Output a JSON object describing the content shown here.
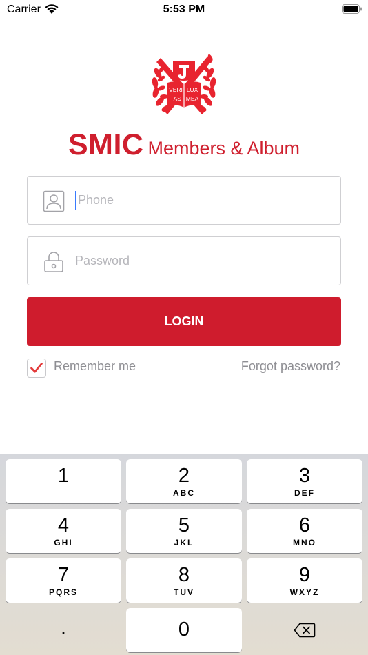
{
  "status_bar": {
    "carrier": "Carrier",
    "time": "5:53 PM",
    "wifi_icon": "wifi-icon",
    "battery_icon": "battery-icon"
  },
  "logo": {
    "icon": "university-crest-icon",
    "motto_lines": [
      "VERI",
      "LUX",
      "TAS",
      "MEA"
    ],
    "color": "#cf1f2e"
  },
  "brand": {
    "main": "SMIC",
    "sub": "Members & Album"
  },
  "form": {
    "phone_placeholder": "Phone",
    "password_placeholder": "Password",
    "login_label": "LOGIN",
    "remember_label": "Remember me",
    "remember_checked": true,
    "forgot_label": "Forgot password?"
  },
  "keyboard": {
    "keys": [
      {
        "num": "1",
        "letters": ""
      },
      {
        "num": "2",
        "letters": "ABC"
      },
      {
        "num": "3",
        "letters": "DEF"
      },
      {
        "num": "4",
        "letters": "GHI"
      },
      {
        "num": "5",
        "letters": "JKL"
      },
      {
        "num": "6",
        "letters": "MNO"
      },
      {
        "num": "7",
        "letters": "PQRS"
      },
      {
        "num": "8",
        "letters": "TUV"
      },
      {
        "num": "9",
        "letters": "WXYZ"
      },
      {
        "num": ".",
        "letters": ""
      },
      {
        "num": "0",
        "letters": ""
      }
    ],
    "delete_icon": "backspace-icon"
  },
  "colors": {
    "accent": "#cf1c2d",
    "placeholder": "#b6b6bb",
    "secondary_text": "#8e8e93"
  }
}
